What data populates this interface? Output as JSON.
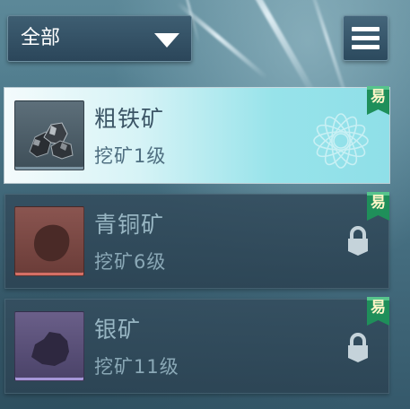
{
  "filter": {
    "selected": "全部"
  },
  "menu": {
    "icon": "hamburger-menu-icon"
  },
  "items": [
    {
      "name": "粗铁矿",
      "requirement": "挖矿1级",
      "badge": "易",
      "state": "selected",
      "icon": "iron-ore-icon",
      "rarity_color": "#7d95a3"
    },
    {
      "name": "青铜矿",
      "requirement": "挖矿6级",
      "badge": "易",
      "state": "locked",
      "icon": "bronze-ore-silhouette-icon",
      "rarity_color": "#d56f65"
    },
    {
      "name": "银矿",
      "requirement": "挖矿11级",
      "badge": "易",
      "state": "locked",
      "icon": "silver-ore-silhouette-icon",
      "rarity_color": "#a596d8"
    }
  ],
  "colors": {
    "selected_gradient_end": "#8fdfe8",
    "badge_green": "#1f8f5a",
    "lock_color": "#c5d3da"
  }
}
